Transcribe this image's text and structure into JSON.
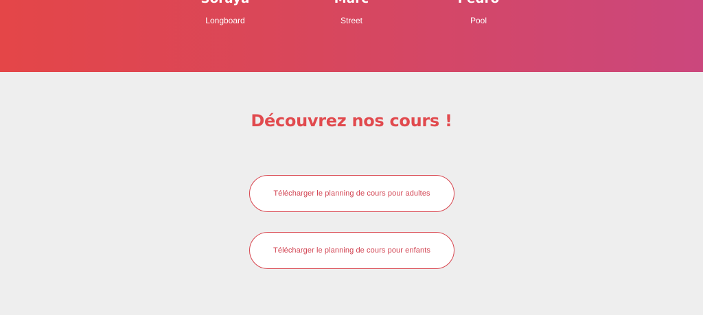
{
  "hero": {
    "coaches": [
      {
        "name": "Soraya",
        "style": "Longboard"
      },
      {
        "name": "Marc",
        "style": "Street"
      },
      {
        "name": "Pedro",
        "style": "Pool"
      }
    ],
    "gradient": [
      "#e44648",
      "#cb477d"
    ]
  },
  "courses": {
    "title": "Découvrez nos cours !",
    "buttons": {
      "adults_label": "Télécharger le planning de cours pour adultes",
      "kids_label": "Télécharger le planning de cours pour enfants"
    },
    "accent_color": "#e14a4e"
  }
}
